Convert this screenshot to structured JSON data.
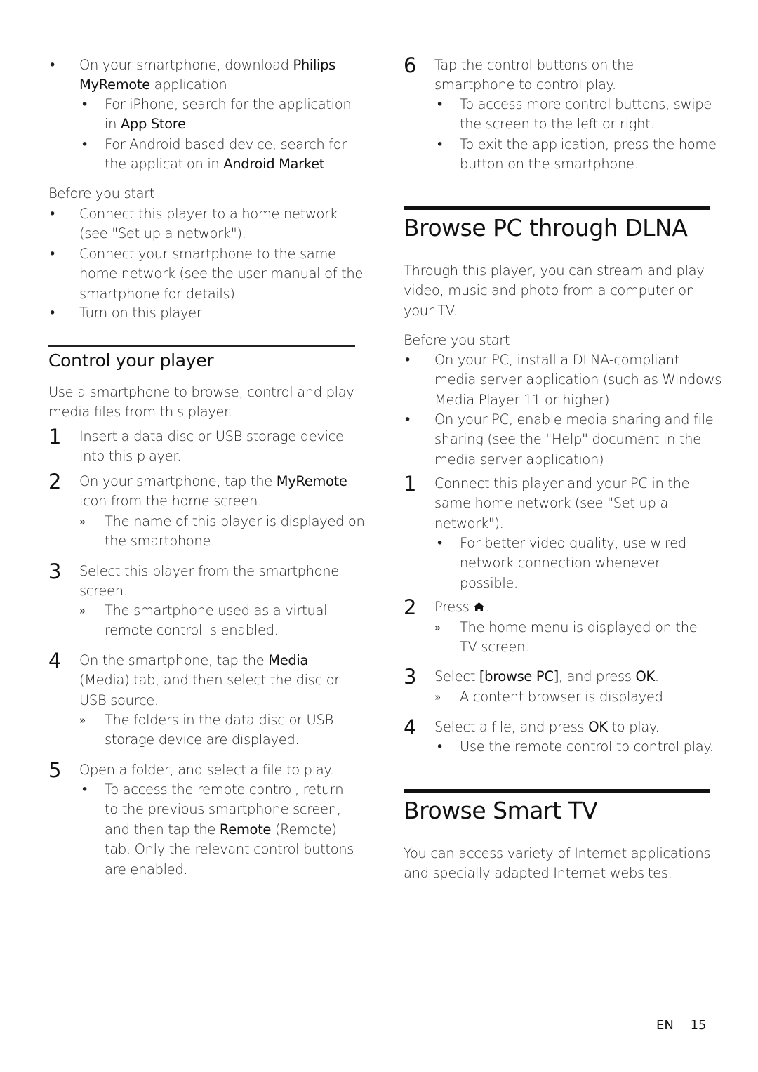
{
  "left_column": {
    "intro_bullet": {
      "lines": [
        [
          "On your smartphone, download ",
          {
            "b": "Philips"
          }
        ],
        [
          {
            "b": "MyRemote"
          },
          " application"
        ]
      ],
      "sub_bullets": [
        {
          "lines": [
            [
              "For iPhone, search for the application"
            ],
            [
              "in ",
              {
                "b": "App Store"
              }
            ]
          ]
        },
        {
          "lines": [
            [
              "For Android based device, search for"
            ],
            [
              "the application in ",
              {
                "b": "Android Market"
              }
            ]
          ]
        }
      ]
    },
    "before_you_start": {
      "heading": "Before you start",
      "bullets": [
        {
          "lines": [
            [
              "Connect this player to a home network"
            ],
            [
              "(see \"Set up a network\")."
            ]
          ]
        },
        {
          "lines": [
            [
              "Connect your smartphone to the same"
            ],
            [
              "home network (see the user manual of the"
            ],
            [
              "smartphone for details)."
            ]
          ]
        },
        {
          "lines": [
            [
              "Turn on this player"
            ]
          ]
        }
      ]
    },
    "control_section": {
      "heading": "Control your player",
      "intro_lines": [
        [
          "Use a smartphone to browse, control and play"
        ],
        [
          "media files from this player."
        ]
      ],
      "steps": [
        {
          "number": "1",
          "lines": [
            [
              "Insert a data disc or USB storage device"
            ],
            [
              "into this player."
            ]
          ]
        },
        {
          "number": "2",
          "lines": [
            [
              "On your smartphone, tap the ",
              {
                "b": "MyRemote"
              }
            ],
            [
              "icon from the home screen."
            ]
          ],
          "result": {
            "lines": [
              [
                "The name of this player is displayed on"
              ],
              [
                "the smartphone."
              ]
            ]
          }
        },
        {
          "number": "3",
          "lines": [
            [
              "Select this player from the smartphone"
            ],
            [
              "screen."
            ]
          ],
          "result": {
            "lines": [
              [
                "The smartphone used as a virtual"
              ],
              [
                "remote control is enabled."
              ]
            ]
          }
        },
        {
          "number": "4",
          "lines": [
            [
              "On the smartphone, tap the ",
              {
                "b": "Media"
              }
            ],
            [
              "(Media) tab, and then select the disc or"
            ],
            [
              "USB source."
            ]
          ],
          "result": {
            "lines": [
              [
                "The folders in the data disc or USB"
              ],
              [
                "storage device are displayed."
              ]
            ]
          }
        },
        {
          "number": "5",
          "lines": [
            [
              "Open a folder, and select a file to play."
            ]
          ],
          "bullet": {
            "lines": [
              [
                "To access the remote control, return"
              ],
              [
                "to the previous smartphone screen,"
              ],
              [
                "and then tap the ",
                {
                  "b": "Remote"
                },
                " (Remote)"
              ],
              [
                "tab. Only the relevant control buttons"
              ],
              [
                "are enabled."
              ]
            ]
          }
        }
      ]
    }
  },
  "right_column": {
    "step6": {
      "number": "6",
      "lines": [
        [
          "Tap the control buttons on the"
        ],
        [
          "smartphone to control play."
        ]
      ],
      "bullets": [
        {
          "lines": [
            [
              "To access more control buttons, swipe"
            ],
            [
              "the screen to the left or right."
            ]
          ]
        },
        {
          "lines": [
            [
              "To exit the application, press the home"
            ],
            [
              "button on the smartphone."
            ]
          ]
        }
      ]
    },
    "dlna_section": {
      "heading": "Browse PC through DLNA",
      "intro_lines": [
        [
          "Through this player, you can stream and play"
        ],
        [
          "video, music and photo from a computer on"
        ],
        [
          "your TV."
        ]
      ],
      "before_heading": "Before you start",
      "before_bullets": [
        {
          "lines": [
            [
              "On your PC, install a DLNA-compliant"
            ],
            [
              "media server application (such as Windows"
            ],
            [
              "Media Player 11 or higher)"
            ]
          ]
        },
        {
          "lines": [
            [
              "On your PC, enable media sharing and file"
            ],
            [
              "sharing (see the \"Help\" document in the"
            ],
            [
              "media server application)"
            ]
          ]
        }
      ],
      "steps": [
        {
          "number": "1",
          "lines": [
            [
              "Connect this player and your PC in the"
            ],
            [
              "same home network (see \"Set up a"
            ],
            [
              "network\")."
            ]
          ],
          "bullet": {
            "lines": [
              [
                "For better video quality, use wired"
              ],
              [
                "network connection whenever"
              ],
              [
                "possible."
              ]
            ]
          }
        },
        {
          "number": "2",
          "press_label": "Press ",
          "press_icon": "home-icon",
          "press_suffix": ".",
          "result": {
            "lines": [
              [
                "The home menu is displayed on the"
              ],
              [
                "TV screen."
              ]
            ]
          }
        },
        {
          "number": "3",
          "lines": [
            [
              "Select ",
              {
                "b": "[browse PC]"
              },
              ", and press ",
              {
                "b": "OK"
              },
              "."
            ]
          ],
          "result": {
            "lines": [
              [
                "A content browser is displayed."
              ]
            ]
          }
        },
        {
          "number": "4",
          "lines": [
            [
              "Select a file, and press ",
              {
                "b": "OK"
              },
              " to play."
            ]
          ],
          "bullet": {
            "lines": [
              [
                "Use the remote control to control play."
              ]
            ]
          }
        }
      ]
    },
    "smart_tv_section": {
      "heading": "Browse Smart TV",
      "intro_lines": [
        [
          "You can access variety of Internet applications"
        ],
        [
          "and specially adapted Internet websites."
        ]
      ]
    }
  },
  "markers": {
    "bullet": "•",
    "result": "»"
  },
  "footer": {
    "language": "EN",
    "page_number": "15"
  }
}
